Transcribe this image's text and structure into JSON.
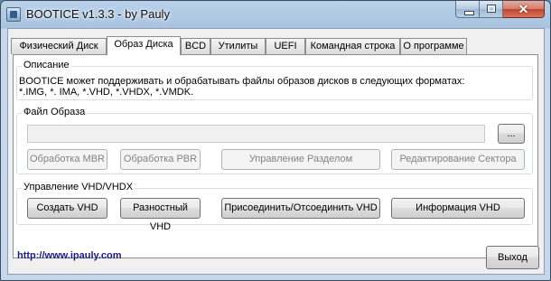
{
  "window": {
    "title": "BOOTICE v1.3.3 - by Pauly",
    "close_symbol": "✕"
  },
  "tabs": [
    {
      "label": "Физический Диск",
      "active": false
    },
    {
      "label": "Образ Диска",
      "active": true
    },
    {
      "label": "BCD",
      "active": false
    },
    {
      "label": "Утилиты",
      "active": false
    },
    {
      "label": "UEFI",
      "active": false
    },
    {
      "label": "Командная строка",
      "active": false
    },
    {
      "label": "О программе",
      "active": false
    }
  ],
  "description": {
    "label": "Описание",
    "text": "BOOTICE может поддерживать и обрабатывать файлы образов дисков в следующих форматах:\n*.IMG, *. IMA, *.VHD, *.VHDX, *.VMDK."
  },
  "image_file": {
    "label": "Файл Образа",
    "value": "",
    "browse_label": "...",
    "buttons": [
      "Обработка MBR",
      "Обработка PBR",
      "Управление Разделом",
      "Редактирование Сектора"
    ]
  },
  "vhd": {
    "label": "Управление VHD/VHDX",
    "buttons": [
      "Создать VHD",
      "Разностный VHD",
      "Присоединить/Отсоединить VHD",
      "Информация VHD"
    ]
  },
  "footer": {
    "link": "http://www.ipauly.com",
    "exit_label": "Выход"
  }
}
